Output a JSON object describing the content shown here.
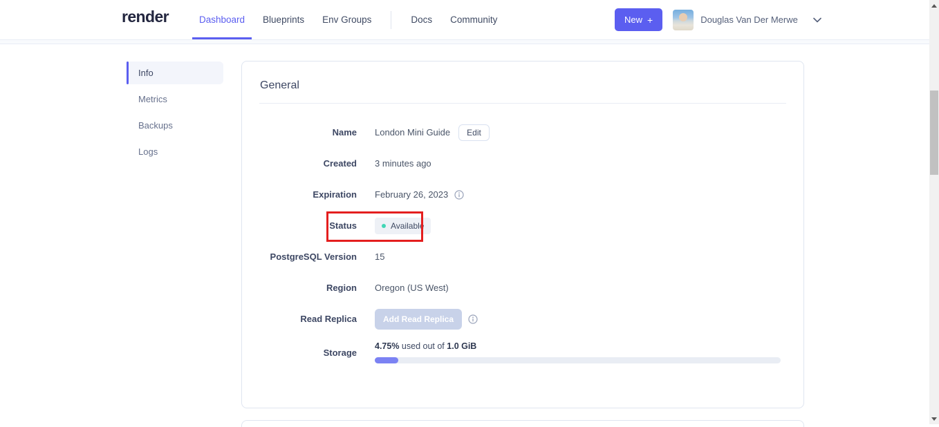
{
  "header": {
    "logo": "render",
    "nav": [
      {
        "label": "Dashboard",
        "active": true
      },
      {
        "label": "Blueprints",
        "active": false
      },
      {
        "label": "Env Groups",
        "active": false
      },
      {
        "label": "Docs",
        "active": false
      },
      {
        "label": "Community",
        "active": false
      }
    ],
    "new_button": {
      "label": "New",
      "plus_icon": "+"
    },
    "user": {
      "name": "Douglas Van Der Merwe"
    }
  },
  "sidebar": {
    "items": [
      {
        "label": "Info",
        "active": true
      },
      {
        "label": "Metrics",
        "active": false
      },
      {
        "label": "Backups",
        "active": false
      },
      {
        "label": "Logs",
        "active": false
      }
    ]
  },
  "general_card": {
    "title": "General",
    "name": {
      "label": "Name",
      "value": "London Mini Guide",
      "edit_button": "Edit"
    },
    "created": {
      "label": "Created",
      "value": "3 minutes ago"
    },
    "expiration": {
      "label": "Expiration",
      "value": "February 26, 2023"
    },
    "status": {
      "label": "Status",
      "badge": "Available",
      "badge_dot_color": "#41d6b5"
    },
    "postgresql_version": {
      "label": "PostgreSQL Version",
      "value": "15"
    },
    "region": {
      "label": "Region",
      "value": "Oregon (US West)"
    },
    "read_replica": {
      "label": "Read Replica",
      "button": "Add Read Replica",
      "button_disabled": true
    },
    "storage": {
      "label": "Storage",
      "used_percent": "4.75%",
      "middle_text": " used out of ",
      "total": "1.0 GiB",
      "percent_value": 4.75
    }
  },
  "annotation": {
    "shape": "red-rectangle",
    "around": "status-row",
    "color": "#e41e1e"
  },
  "colors": {
    "accent": "#5b5ef0",
    "progress_fill": "#7b82f3",
    "badge_dot": "#41d6b5",
    "card_border": "#dfe5f0"
  }
}
